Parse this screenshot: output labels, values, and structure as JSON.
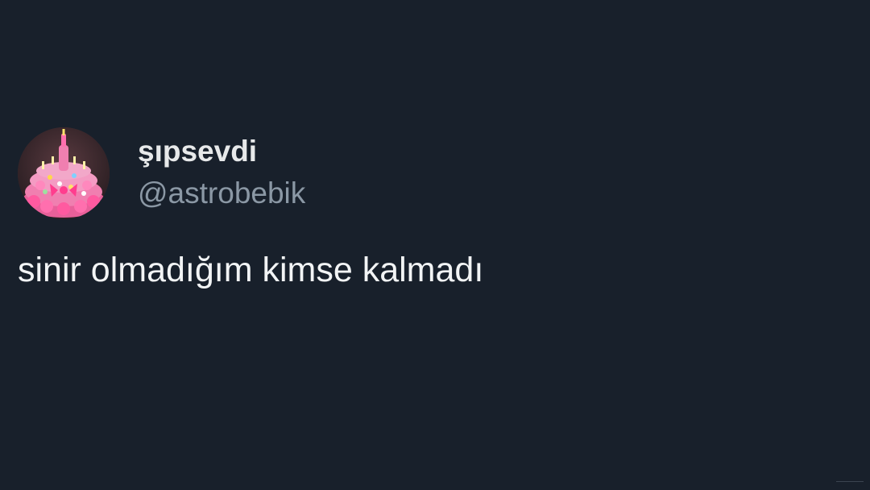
{
  "tweet": {
    "author": {
      "display_name": "şıpsevdi",
      "handle": "@astrobebik",
      "avatar_icon": "pink-balloon-cake-avatar"
    },
    "text": "sinir olmadığım kimse kalmadı"
  },
  "colors": {
    "background": "#18202b",
    "primary_text": "#e7e9ea",
    "secondary_text": "#8b98a5",
    "avatar_pink": "#e8609a"
  }
}
